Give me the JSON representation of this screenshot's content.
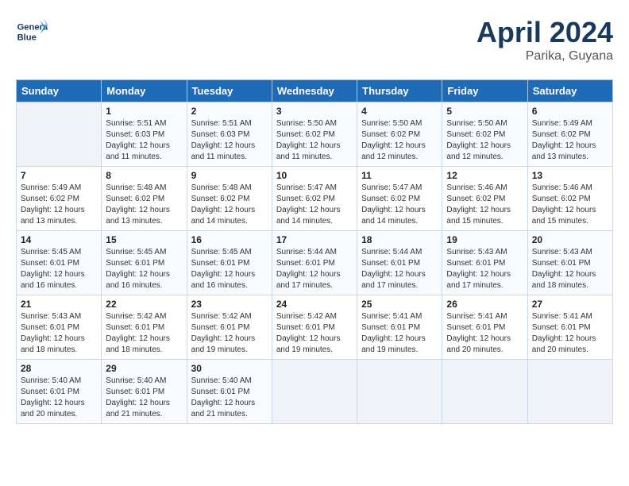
{
  "header": {
    "logo_line1": "General",
    "logo_line2": "Blue",
    "month": "April 2024",
    "location": "Parika, Guyana"
  },
  "columns": [
    "Sunday",
    "Monday",
    "Tuesday",
    "Wednesday",
    "Thursday",
    "Friday",
    "Saturday"
  ],
  "weeks": [
    [
      {
        "day": "",
        "info": ""
      },
      {
        "day": "1",
        "info": "Sunrise: 5:51 AM\nSunset: 6:03 PM\nDaylight: 12 hours\nand 11 minutes."
      },
      {
        "day": "2",
        "info": "Sunrise: 5:51 AM\nSunset: 6:03 PM\nDaylight: 12 hours\nand 11 minutes."
      },
      {
        "day": "3",
        "info": "Sunrise: 5:50 AM\nSunset: 6:02 PM\nDaylight: 12 hours\nand 11 minutes."
      },
      {
        "day": "4",
        "info": "Sunrise: 5:50 AM\nSunset: 6:02 PM\nDaylight: 12 hours\nand 12 minutes."
      },
      {
        "day": "5",
        "info": "Sunrise: 5:50 AM\nSunset: 6:02 PM\nDaylight: 12 hours\nand 12 minutes."
      },
      {
        "day": "6",
        "info": "Sunrise: 5:49 AM\nSunset: 6:02 PM\nDaylight: 12 hours\nand 13 minutes."
      }
    ],
    [
      {
        "day": "7",
        "info": "Sunrise: 5:49 AM\nSunset: 6:02 PM\nDaylight: 12 hours\nand 13 minutes."
      },
      {
        "day": "8",
        "info": "Sunrise: 5:48 AM\nSunset: 6:02 PM\nDaylight: 12 hours\nand 13 minutes."
      },
      {
        "day": "9",
        "info": "Sunrise: 5:48 AM\nSunset: 6:02 PM\nDaylight: 12 hours\nand 14 minutes."
      },
      {
        "day": "10",
        "info": "Sunrise: 5:47 AM\nSunset: 6:02 PM\nDaylight: 12 hours\nand 14 minutes."
      },
      {
        "day": "11",
        "info": "Sunrise: 5:47 AM\nSunset: 6:02 PM\nDaylight: 12 hours\nand 14 minutes."
      },
      {
        "day": "12",
        "info": "Sunrise: 5:46 AM\nSunset: 6:02 PM\nDaylight: 12 hours\nand 15 minutes."
      },
      {
        "day": "13",
        "info": "Sunrise: 5:46 AM\nSunset: 6:02 PM\nDaylight: 12 hours\nand 15 minutes."
      }
    ],
    [
      {
        "day": "14",
        "info": "Sunrise: 5:45 AM\nSunset: 6:01 PM\nDaylight: 12 hours\nand 16 minutes."
      },
      {
        "day": "15",
        "info": "Sunrise: 5:45 AM\nSunset: 6:01 PM\nDaylight: 12 hours\nand 16 minutes."
      },
      {
        "day": "16",
        "info": "Sunrise: 5:45 AM\nSunset: 6:01 PM\nDaylight: 12 hours\nand 16 minutes."
      },
      {
        "day": "17",
        "info": "Sunrise: 5:44 AM\nSunset: 6:01 PM\nDaylight: 12 hours\nand 17 minutes."
      },
      {
        "day": "18",
        "info": "Sunrise: 5:44 AM\nSunset: 6:01 PM\nDaylight: 12 hours\nand 17 minutes."
      },
      {
        "day": "19",
        "info": "Sunrise: 5:43 AM\nSunset: 6:01 PM\nDaylight: 12 hours\nand 17 minutes."
      },
      {
        "day": "20",
        "info": "Sunrise: 5:43 AM\nSunset: 6:01 PM\nDaylight: 12 hours\nand 18 minutes."
      }
    ],
    [
      {
        "day": "21",
        "info": "Sunrise: 5:43 AM\nSunset: 6:01 PM\nDaylight: 12 hours\nand 18 minutes."
      },
      {
        "day": "22",
        "info": "Sunrise: 5:42 AM\nSunset: 6:01 PM\nDaylight: 12 hours\nand 18 minutes."
      },
      {
        "day": "23",
        "info": "Sunrise: 5:42 AM\nSunset: 6:01 PM\nDaylight: 12 hours\nand 19 minutes."
      },
      {
        "day": "24",
        "info": "Sunrise: 5:42 AM\nSunset: 6:01 PM\nDaylight: 12 hours\nand 19 minutes."
      },
      {
        "day": "25",
        "info": "Sunrise: 5:41 AM\nSunset: 6:01 PM\nDaylight: 12 hours\nand 19 minutes."
      },
      {
        "day": "26",
        "info": "Sunrise: 5:41 AM\nSunset: 6:01 PM\nDaylight: 12 hours\nand 20 minutes."
      },
      {
        "day": "27",
        "info": "Sunrise: 5:41 AM\nSunset: 6:01 PM\nDaylight: 12 hours\nand 20 minutes."
      }
    ],
    [
      {
        "day": "28",
        "info": "Sunrise: 5:40 AM\nSunset: 6:01 PM\nDaylight: 12 hours\nand 20 minutes."
      },
      {
        "day": "29",
        "info": "Sunrise: 5:40 AM\nSunset: 6:01 PM\nDaylight: 12 hours\nand 21 minutes."
      },
      {
        "day": "30",
        "info": "Sunrise: 5:40 AM\nSunset: 6:01 PM\nDaylight: 12 hours\nand 21 minutes."
      },
      {
        "day": "",
        "info": ""
      },
      {
        "day": "",
        "info": ""
      },
      {
        "day": "",
        "info": ""
      },
      {
        "day": "",
        "info": ""
      }
    ]
  ]
}
